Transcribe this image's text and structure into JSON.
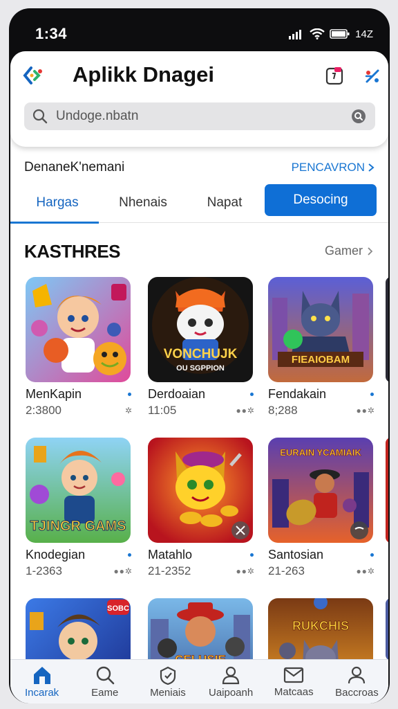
{
  "status_bar": {
    "time": "1:34",
    "battery_text": "14Z"
  },
  "header": {
    "title": "Aplikk Dnagei",
    "search_value": "Undoge.nbatn"
  },
  "subheader": {
    "title": "DenaneK'nemani",
    "link": "PENCAVRON"
  },
  "tabs": [
    {
      "label": "Hargas",
      "active": true
    },
    {
      "label": "Nhenais",
      "active": false
    },
    {
      "label": "Napat",
      "active": false
    }
  ],
  "tab_button": "Desocing",
  "section": {
    "title": "KASTHRES",
    "link": "Gamer"
  },
  "games": [
    {
      "name": "MenKapin",
      "meta": "2:3800",
      "icon": "game-art-hero-fox",
      "banner": ""
    },
    {
      "name": "Derdoaian",
      "meta": "11:05",
      "icon": "game-art-cat-hero",
      "banner": "VONCHUJK",
      "banner2": "OU SGPPION"
    },
    {
      "name": "Fendakain",
      "meta": "8;288",
      "icon": "game-art-wolf-warrior",
      "banner": "FIEAIOBAM"
    },
    {
      "name": "Knodegian",
      "meta": "1-2363",
      "icon": "game-art-boy-garden",
      "banner": "TJINGR GAMS"
    },
    {
      "name": "Matahlo",
      "meta": "21-2352",
      "icon": "game-art-cat-coins",
      "banner": ""
    },
    {
      "name": "Santosian",
      "meta": "21-263",
      "icon": "game-art-pirate-city",
      "banner": "EURAIN YCAMIAIK"
    },
    {
      "name": "",
      "meta": "",
      "icon": "game-art-boy-blue",
      "banner": "SOBC"
    },
    {
      "name": "",
      "meta": "",
      "icon": "game-art-hat-hero",
      "banner": "CELUSIE"
    },
    {
      "name": "",
      "meta": "",
      "icon": "game-art-wolf-fire",
      "banner": "RUKCHIS"
    }
  ],
  "bottom_nav": [
    {
      "label": "Incarak",
      "icon": "home-icon",
      "active": true
    },
    {
      "label": "Eame",
      "icon": "search-icon",
      "active": false
    },
    {
      "label": "Meniais",
      "icon": "compass-icon",
      "active": false
    },
    {
      "label": "Uaipoanh",
      "icon": "user-group-icon",
      "active": false
    },
    {
      "label": "Matcaas",
      "icon": "mail-icon",
      "active": false
    },
    {
      "label": "Baccroas",
      "icon": "profile-icon",
      "active": false
    }
  ],
  "colors": {
    "accent": "#1976d2",
    "tab_button": "#0f6fd6",
    "frame": "#0d0d0f"
  }
}
